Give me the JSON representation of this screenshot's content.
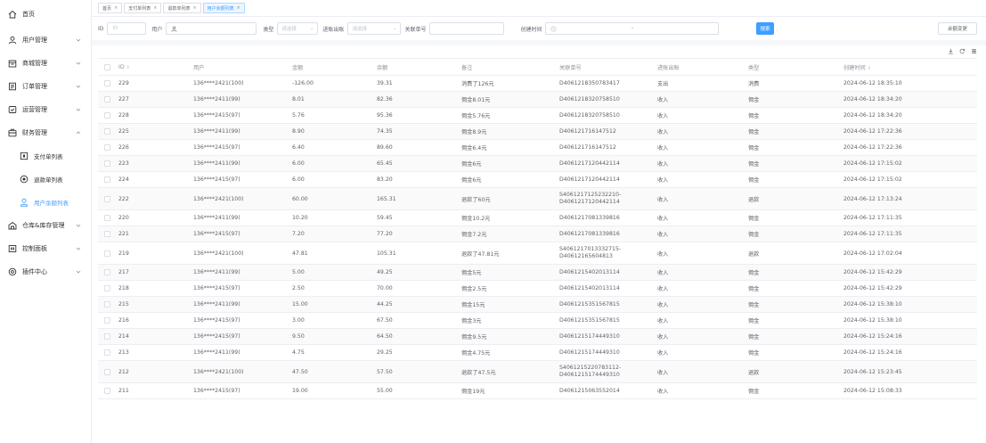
{
  "sidebar": {
    "home": "首页",
    "items": [
      {
        "label": "用户管理",
        "icon": "user-icon"
      },
      {
        "label": "商城管理",
        "icon": "shop-icon"
      },
      {
        "label": "订单管理",
        "icon": "order-icon"
      },
      {
        "label": "运营管理",
        "icon": "operation-icon"
      },
      {
        "label": "财务管理",
        "icon": "finance-icon"
      }
    ],
    "finance_sub": [
      {
        "label": "支付单列表",
        "icon": "payment-icon"
      },
      {
        "label": "退款单列表",
        "icon": "refund-icon"
      },
      {
        "label": "用户余额列表",
        "icon": "balance-icon"
      }
    ],
    "items_after": [
      {
        "label": "仓库&库存管理",
        "icon": "warehouse-icon"
      },
      {
        "label": "控制面板",
        "icon": "dashboard-icon"
      },
      {
        "label": "插件中心",
        "icon": "plugin-icon"
      }
    ]
  },
  "tabs": [
    {
      "label": "首页"
    },
    {
      "label": "支付单列表"
    },
    {
      "label": "退款单列表"
    },
    {
      "label": "用户余额列表"
    }
  ],
  "filters": {
    "id_label": "ID",
    "id_placeholder": "ID",
    "user_label": "用户",
    "type_label": "类型",
    "type_placeholder": "请选择",
    "dir_label": "进账出账",
    "dir_placeholder": "请选择",
    "order_label": "关联单号",
    "created_label": "创建时间",
    "date_sep": "-",
    "search_button": "搜索",
    "balance_button": "余额变更"
  },
  "table": {
    "columns": [
      "ID",
      "用户",
      "金额",
      "余额",
      "备注",
      "关联单号",
      "进账出账",
      "类型",
      "创建时间"
    ],
    "rows": [
      {
        "id": "229",
        "user": "136****2421(100)",
        "amount": "-126.00",
        "balance": "39.31",
        "remark": "消费了126元",
        "order": "D4061218350783417",
        "dir": "支出",
        "type": "消费",
        "time": "2024-06-12 18:35:10"
      },
      {
        "id": "227",
        "user": "136****2411(99)",
        "amount": "8.01",
        "balance": "82.36",
        "remark": "佣金8.01元",
        "order": "D4061218320758510",
        "dir": "收入",
        "type": "佣金",
        "time": "2024-06-12 18:34:20"
      },
      {
        "id": "228",
        "user": "136****2415(97)",
        "amount": "5.76",
        "balance": "95.36",
        "remark": "佣金5.76元",
        "order": "D4061218320758510",
        "dir": "收入",
        "type": "佣金",
        "time": "2024-06-12 18:34:20"
      },
      {
        "id": "225",
        "user": "136****2411(99)",
        "amount": "8.90",
        "balance": "74.35",
        "remark": "佣金8.9元",
        "order": "D4061217161475​12",
        "dir": "收入",
        "type": "佣金",
        "time": "2024-06-12 17:22:36"
      },
      {
        "id": "226",
        "user": "136****2415(97)",
        "amount": "6.40",
        "balance": "89.60",
        "remark": "佣金6.4元",
        "order": "D406121716147512",
        "dir": "收入",
        "type": "佣金",
        "time": "2024-06-12 17:22:36"
      },
      {
        "id": "223",
        "user": "136****2411(99)",
        "amount": "6.00",
        "balance": "65.45",
        "remark": "佣金6元",
        "order": "D4061217120442114",
        "dir": "收入",
        "type": "佣金",
        "time": "2024-06-12 17:15:02"
      },
      {
        "id": "224",
        "user": "136****2415(97)",
        "amount": "6.00",
        "balance": "83.20",
        "remark": "佣金6元",
        "order": "D4061217120442114",
        "dir": "收入",
        "type": "佣金",
        "time": "2024-06-12 17:15:02"
      },
      {
        "id": "222",
        "user": "136****2421(100)",
        "amount": "60.00",
        "balance": "165.31",
        "remark": "退款了60元",
        "order": "S4061217125232210-D4061217120442114",
        "dir": "收入",
        "type": "退款",
        "time": "2024-06-12 17:13:24"
      },
      {
        "id": "220",
        "user": "136****2411(99)",
        "amount": "10.20",
        "balance": "59.45",
        "remark": "佣金10.2元",
        "order": "D4061217081339816",
        "dir": "收入",
        "type": "佣金",
        "time": "2024-06-12 17:11:35"
      },
      {
        "id": "221",
        "user": "136****2415(97)",
        "amount": "7.20",
        "balance": "77.20",
        "remark": "佣金7.2元",
        "order": "D4061217081339816",
        "dir": "收入",
        "type": "佣金",
        "time": "2024-06-12 17:11:35"
      },
      {
        "id": "219",
        "user": "136****2421(100)",
        "amount": "47.81",
        "balance": "105.31",
        "remark": "退款了47.81元",
        "order": "S4061217013332715-D40612165604813",
        "dir": "收入",
        "type": "退款",
        "time": "2024-06-12 17:02:04"
      },
      {
        "id": "217",
        "user": "136****2411(99)",
        "amount": "5.00",
        "balance": "49.25",
        "remark": "佣金5元",
        "order": "D4061215402013114",
        "dir": "收入",
        "type": "佣金",
        "time": "2024-06-12 15:42:29"
      },
      {
        "id": "218",
        "user": "136****2415(97)",
        "amount": "2.50",
        "balance": "70.00",
        "remark": "佣金2.5元",
        "order": "D4061215402013114",
        "dir": "收入",
        "type": "佣金",
        "time": "2024-06-12 15:42:29"
      },
      {
        "id": "215",
        "user": "136****2411(99)",
        "amount": "15.00",
        "balance": "44.25",
        "remark": "佣金15元",
        "order": "D4061215351567815",
        "dir": "收入",
        "type": "佣金",
        "time": "2024-06-12 15:38:10"
      },
      {
        "id": "216",
        "user": "136****2415(97)",
        "amount": "3.00",
        "balance": "67.50",
        "remark": "佣金3元",
        "order": "D4061215351567815",
        "dir": "收入",
        "type": "佣金",
        "time": "2024-06-12 15:38:10"
      },
      {
        "id": "214",
        "user": "136****2415(97)",
        "amount": "9.50",
        "balance": "64.50",
        "remark": "佣金9.5元",
        "order": "D4061215174449310",
        "dir": "收入",
        "type": "佣金",
        "time": "2024-06-12 15:24:16"
      },
      {
        "id": "213",
        "user": "136****2411(99)",
        "amount": "4.75",
        "balance": "29.25",
        "remark": "佣金4.75元",
        "order": "D4061215174449310",
        "dir": "收入",
        "type": "佣金",
        "time": "2024-06-12 15:24:16"
      },
      {
        "id": "212",
        "user": "136****2421(100)",
        "amount": "47.50",
        "balance": "57.50",
        "remark": "退款了47.5元",
        "order": "S4061215220783112-D4061215174449310",
        "dir": "收入",
        "type": "退款",
        "time": "2024-06-12 15:23:45"
      },
      {
        "id": "211",
        "user": "136****2415(97)",
        "amount": "19.00",
        "balance": "55.00",
        "remark": "佣金19元",
        "order": "D4061215063552014",
        "dir": "收入",
        "type": "佣金",
        "time": "2024-06-12 15:08:33"
      }
    ]
  },
  "colors": {
    "accent": "#409eff",
    "border": "#ebeef5",
    "text": "#606266"
  }
}
